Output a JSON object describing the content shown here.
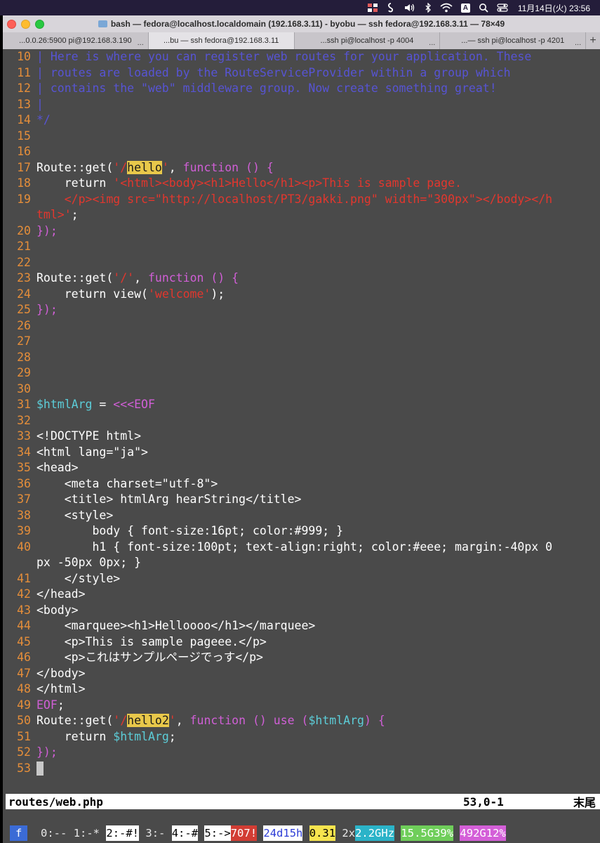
{
  "menubar": {
    "clock": "11月14日(火) 23:56",
    "input_mode": "A"
  },
  "window": {
    "title": "bash — fedora@localhost.localdomain (192.168.3.11) - byobu — ssh fedora@192.168.3.11 — 78×49",
    "tabs": [
      {
        "label": "...0.0.26:5900 pi@192.168.3.190",
        "more": "...",
        "active": false
      },
      {
        "label": "...bu — ssh fedora@192.168.3.11",
        "more": "",
        "active": true
      },
      {
        "label": "...ssh pi@localhost -p 4004",
        "more": "...",
        "active": false
      },
      {
        "label": "...— ssh pi@localhost -p 4201",
        "more": "...",
        "active": false
      }
    ],
    "add_tab": "+"
  },
  "editor": {
    "lines": [
      {
        "n": "10",
        "segs": [
          [
            "c-comment",
            "| Here is where you can register web routes for your application. These"
          ]
        ]
      },
      {
        "n": "11",
        "segs": [
          [
            "c-comment",
            "| routes are loaded by the RouteServiceProvider within a group which"
          ]
        ]
      },
      {
        "n": "12",
        "segs": [
          [
            "c-comment",
            "| contains the \"web\" middleware group. Now create something great!"
          ]
        ]
      },
      {
        "n": "13",
        "segs": [
          [
            "c-comment",
            "|"
          ]
        ]
      },
      {
        "n": "14",
        "segs": [
          [
            "c-comment",
            "*/"
          ]
        ]
      },
      {
        "n": "15",
        "segs": []
      },
      {
        "n": "16",
        "segs": []
      },
      {
        "n": "17",
        "segs": [
          [
            "",
            "Route::get("
          ],
          [
            "c-str",
            "'/"
          ],
          [
            "c-hl",
            "hello"
          ],
          [
            "c-str",
            "'"
          ],
          [
            "",
            ", "
          ],
          [
            "c-kw",
            "function () {"
          ]
        ]
      },
      {
        "n": "18",
        "segs": [
          [
            "",
            "    return "
          ],
          [
            "c-str",
            "'<html><body><h1>Hello</h1><p>This is sample page."
          ]
        ]
      },
      {
        "n": "19",
        "segs": [
          [
            "c-str",
            "    </p><img src=\"http://localhost/PT3/gakki.png\" width=\"300px\"></body></h"
          ]
        ]
      },
      {
        "n": "",
        "segs": [
          [
            "c-str",
            "tml>'"
          ],
          [
            "",
            ";"
          ]
        ]
      },
      {
        "n": "20",
        "segs": [
          [
            "c-kw",
            "});"
          ]
        ]
      },
      {
        "n": "21",
        "segs": []
      },
      {
        "n": "22",
        "segs": []
      },
      {
        "n": "23",
        "segs": [
          [
            "",
            "Route::get("
          ],
          [
            "c-str",
            "'/'"
          ],
          [
            "",
            ", "
          ],
          [
            "c-kw",
            "function () {"
          ]
        ]
      },
      {
        "n": "24",
        "segs": [
          [
            "",
            "    return view("
          ],
          [
            "c-str",
            "'welcome'"
          ],
          [
            "",
            ");"
          ]
        ]
      },
      {
        "n": "25",
        "segs": [
          [
            "c-kw",
            "});"
          ]
        ]
      },
      {
        "n": "26",
        "segs": []
      },
      {
        "n": "27",
        "segs": []
      },
      {
        "n": "28",
        "segs": []
      },
      {
        "n": "29",
        "segs": []
      },
      {
        "n": "30",
        "segs": []
      },
      {
        "n": "31",
        "segs": [
          [
            "c-var",
            "$htmlArg"
          ],
          [
            "",
            " = "
          ],
          [
            "c-kw",
            "<<<EOF"
          ]
        ]
      },
      {
        "n": "32",
        "segs": []
      },
      {
        "n": "33",
        "segs": [
          [
            "",
            "<!DOCTYPE html>"
          ]
        ]
      },
      {
        "n": "34",
        "segs": [
          [
            "",
            "<html lang=\"ja\">"
          ]
        ]
      },
      {
        "n": "35",
        "segs": [
          [
            "",
            "<head>"
          ]
        ]
      },
      {
        "n": "36",
        "segs": [
          [
            "",
            "    <meta charset=\"utf-8\">"
          ]
        ]
      },
      {
        "n": "37",
        "segs": [
          [
            "",
            "    <title> htmlArg hearString</title>"
          ]
        ]
      },
      {
        "n": "38",
        "segs": [
          [
            "",
            "    <style>"
          ]
        ]
      },
      {
        "n": "39",
        "segs": [
          [
            "",
            "        body { font-size:16pt; color:#999; }"
          ]
        ]
      },
      {
        "n": "40",
        "segs": [
          [
            "",
            "        h1 { font-size:100pt; text-align:right; color:#eee; margin:-40px 0"
          ]
        ]
      },
      {
        "n": "",
        "segs": [
          [
            "",
            "px -50px 0px; }"
          ]
        ]
      },
      {
        "n": "41",
        "segs": [
          [
            "",
            "    </style>"
          ]
        ]
      },
      {
        "n": "42",
        "segs": [
          [
            "",
            "</head>"
          ]
        ]
      },
      {
        "n": "43",
        "segs": [
          [
            "",
            "<body>"
          ]
        ]
      },
      {
        "n": "44",
        "segs": [
          [
            "",
            "    <marquee><h1>Helloooo</h1></marquee>"
          ]
        ]
      },
      {
        "n": "45",
        "segs": [
          [
            "",
            "    <p>This is sample pageee.</p>"
          ]
        ]
      },
      {
        "n": "46",
        "segs": [
          [
            "",
            "    <p>これはサンプルページでっす</p>"
          ]
        ]
      },
      {
        "n": "47",
        "segs": [
          [
            "",
            "</body>"
          ]
        ]
      },
      {
        "n": "48",
        "segs": [
          [
            "",
            "</html>"
          ]
        ]
      },
      {
        "n": "49",
        "segs": [
          [
            "c-kw",
            "EOF"
          ],
          [
            "",
            ";"
          ]
        ]
      },
      {
        "n": "50",
        "segs": [
          [
            "",
            "Route::get("
          ],
          [
            "c-str",
            "'/"
          ],
          [
            "c-hl",
            "hello2"
          ],
          [
            "c-str",
            "'"
          ],
          [
            "",
            ", "
          ],
          [
            "c-kw",
            "function () use ("
          ],
          [
            "c-var",
            "$htmlArg"
          ],
          [
            "c-kw",
            ") {"
          ]
        ]
      },
      {
        "n": "51",
        "segs": [
          [
            "",
            "    return "
          ],
          [
            "c-var",
            "$htmlArg"
          ],
          [
            "",
            ";"
          ]
        ]
      },
      {
        "n": "52",
        "segs": [
          [
            "c-kw",
            "});"
          ]
        ]
      },
      {
        "n": "53",
        "segs": [
          [
            "cursor",
            ""
          ]
        ]
      }
    ]
  },
  "vim_status": {
    "file": "routes/web.php",
    "position": "53,0-1",
    "scroll": "末尾"
  },
  "byobu": {
    "logo": "f",
    "win0": "0:-- ",
    "win1": "1:-* ",
    "win2": "2:-#!",
    "win3": " 3:- ",
    "win4": "4:-#",
    "win5": "5:->",
    "updates": "707!",
    "uptime": "24d15h",
    "load": "0.31",
    "cpu_prefix": "2x",
    "cpu_freq": "2.2GHz",
    "memory": "15.5G39%",
    "disk": "492G12%"
  },
  "colors": {
    "menubar_bg": "#241d3a",
    "terminal_bg": "#4a4a4a",
    "line_number": "#e58e3a",
    "comment": "#5754d4",
    "string": "#e2372e",
    "keyword": "#d05fd6",
    "variable": "#5ccdd8",
    "search_highlight": "#e8c84a"
  }
}
